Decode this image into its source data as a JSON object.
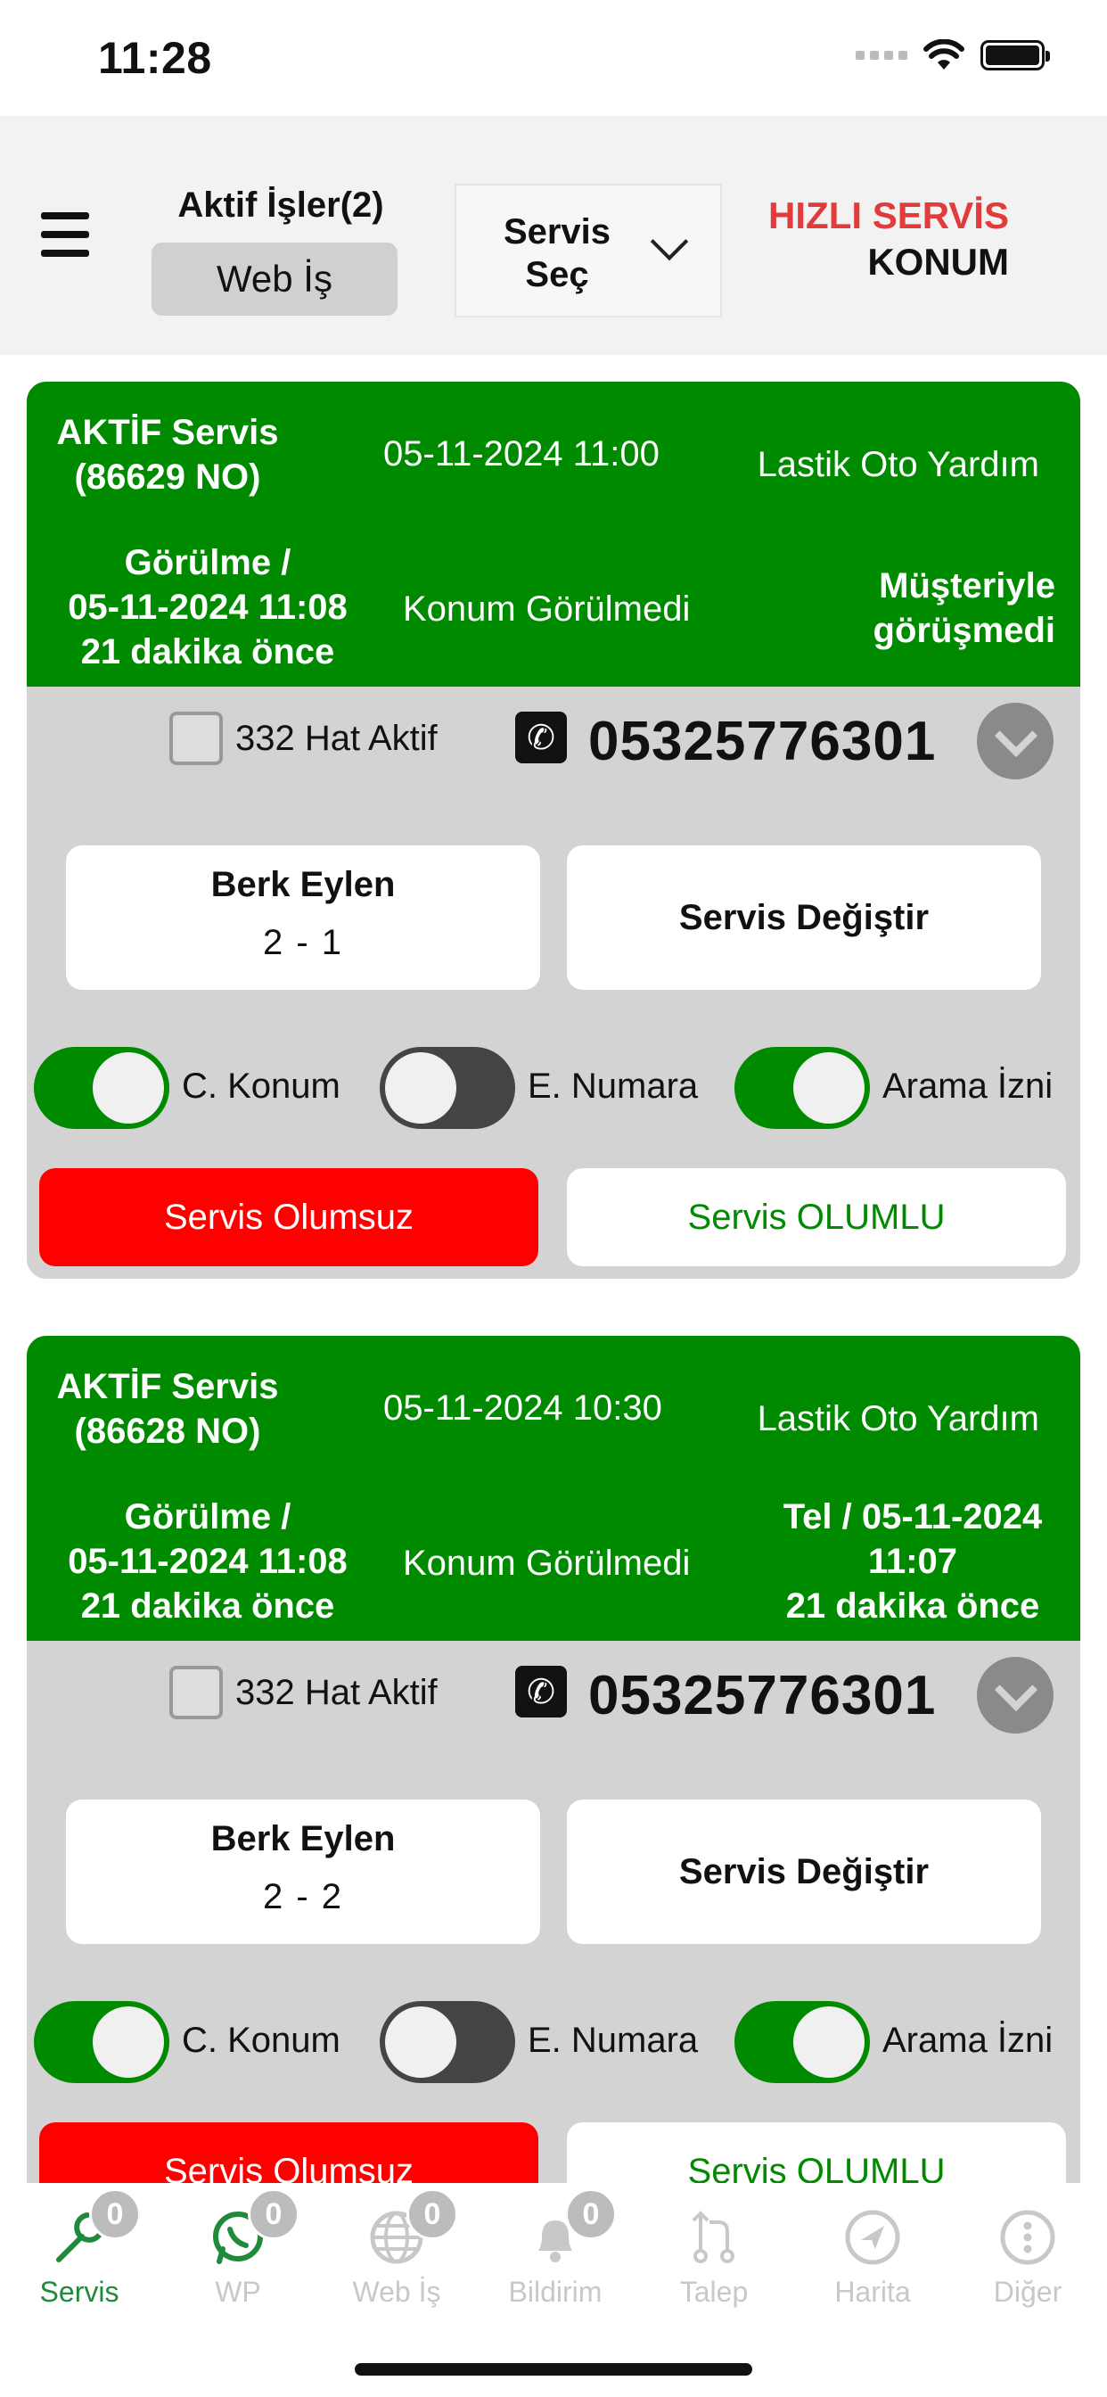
{
  "status_bar": {
    "time": "11:28"
  },
  "header": {
    "active_jobs_label": "Aktif İşler(2)",
    "web_job_button": "Web İş",
    "service_select_line1": "Servis",
    "service_select_line2": "Seç",
    "quick_service_line1": "HIZLI SERVİS",
    "quick_service_line2": "KONUM"
  },
  "cards": [
    {
      "status_line1": "AKTİF Servis",
      "status_line2": "(86629 NO)",
      "datetime": "05-11-2024 11:00",
      "company": "Lastik Oto Yardım",
      "seen_line1": "Görülme /",
      "seen_line2": "05-11-2024 11:08",
      "seen_line3": "21 dakika önce",
      "location_status": "Konum Görülmedi",
      "contact_line1": "Müşteriyle",
      "contact_line2": "görüşmedi",
      "contact_line3": "",
      "hat_label": "332 Hat Aktif",
      "phone": "05325776301",
      "person_name": "Berk Eylen",
      "person_counts": "2 -   1",
      "change_service": "Servis Değiştir",
      "toggle_c_konum": "C. Konum",
      "toggle_e_numara": "E. Numara",
      "toggle_arama": "Arama İzni",
      "btn_negative": "Servis Olumsuz",
      "btn_positive": "Servis OLUMLU"
    },
    {
      "status_line1": "AKTİF Servis",
      "status_line2": "(86628 NO)",
      "datetime": "05-11-2024 10:30",
      "company": "Lastik Oto Yardım",
      "seen_line1": "Görülme /",
      "seen_line2": "05-11-2024 11:08",
      "seen_line3": "21 dakika önce",
      "location_status": "Konum Görülmedi",
      "contact_line1": "Tel / 05-11-2024",
      "contact_line2": "11:07",
      "contact_line3": "21 dakika önce",
      "hat_label": "332 Hat Aktif",
      "phone": "05325776301",
      "person_name": "Berk Eylen",
      "person_counts": "2 -   2",
      "change_service": "Servis Değiştir",
      "toggle_c_konum": "C. Konum",
      "toggle_e_numara": "E. Numara",
      "toggle_arama": "Arama İzni",
      "btn_negative": "Servis Olumsuz",
      "btn_positive": "Servis OLUMLU"
    }
  ],
  "tabbar": [
    {
      "label": "Servis",
      "badge": "0",
      "icon": "wrench-icon"
    },
    {
      "label": "WP",
      "badge": "0",
      "icon": "whatsapp-icon"
    },
    {
      "label": "Web İş",
      "badge": "0",
      "icon": "globe-icon"
    },
    {
      "label": "Bildirim",
      "badge": "0",
      "icon": "bell-icon"
    },
    {
      "label": "Talep",
      "badge": "",
      "icon": "pull-request-icon"
    },
    {
      "label": "Harita",
      "badge": "",
      "icon": "navigation-icon"
    },
    {
      "label": "Diğer",
      "badge": "",
      "icon": "more-icon"
    }
  ],
  "colors": {
    "card_header_green": "#008a00",
    "negative_red": "#ff0000",
    "quick_service_red": "#e23b3b",
    "active_tab_green": "#1e8a3a"
  }
}
